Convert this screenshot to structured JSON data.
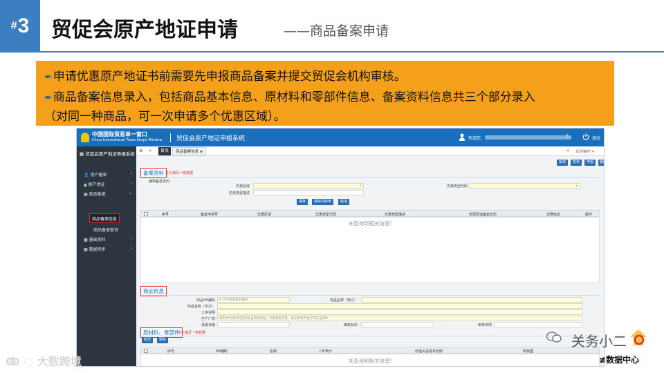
{
  "slide": {
    "hash": "#",
    "number": "3",
    "title": "贸促会原产地证申请",
    "subtitle": "——商品备案申请"
  },
  "callout": {
    "line1": "申请优惠原产地证书前需要先申报商品备案并提交贸促会机构审核。",
    "line2": "商品备案信息录入，包括商品基本信息、原材料和零部件信息、备案资料信息共三个部分录入",
    "line3": "（对同一种商品，可一次申请多个优惠区域）。"
  },
  "app": {
    "logo_cn": "中国国际贸易单一窗口",
    "logo_en": "China International Trade Single Window",
    "system_title": "贸促会原产地证申报系统",
    "welcome": "欢迎您,",
    "welcome_suffix": "5",
    "logout": "退出"
  },
  "sidebar": {
    "header": "贸促会原产地证申报系统",
    "items": [
      {
        "label": "用户备案"
      },
      {
        "label": "原产地证"
      },
      {
        "label": "商品备案"
      }
    ],
    "active_sub": "商品备案信息",
    "sub2": "商品备案查询",
    "items2": [
      {
        "label": "基础资料"
      },
      {
        "label": "数据同步"
      }
    ]
  },
  "tabs": {
    "home": "首页",
    "current": "商品备案信息 ⊗",
    "right": "关闭操作 ▾"
  },
  "toolbar": {
    "b1": "新增",
    "b2": "暂存",
    "b3": "申报",
    "b4": "删除"
  },
  "section1": {
    "label": "备案资料",
    "note": "至少填写一条数据",
    "sub": "编辑备案资料",
    "f1_label": "优惠区域",
    "f2_label": "优惠类型代码",
    "f3_label": "优惠类型描述"
  },
  "actions": {
    "save": "保存",
    "save_new": "保存并新增",
    "cancel": "取消"
  },
  "table1": {
    "headers": [
      "序号",
      "备案申请号",
      "优惠区域",
      "优惠类型代码",
      "优惠类型描述",
      "优惠区域备案状态",
      "详细信息",
      "操作"
    ],
    "empty": "未查询到相关信息!"
  },
  "section2": {
    "label": "商品信息",
    "hs_label": "商品HS编码",
    "hs_placeholder": "6  10位海关商品编码",
    "name_en_label": "商品名称（英文）",
    "name_cn_label": "商品名称（中文）",
    "process_label": "工序说明",
    "maker_label": "生产厂商",
    "maker_placeholder": "请用中文填写制造商的名称和地址，只能填报实际，此信息将不会打印在证书中",
    "date_label": "录报日期",
    "audit_status_label": "审核状态",
    "audit_detail_label": "审核详情"
  },
  "section3": {
    "label": "原材料、零部件",
    "note": "至少填写一条数据",
    "b1": "新增",
    "b2": "删除"
  },
  "table2": {
    "headers": [
      "序号",
      "HS编码",
      "名称",
      "CIF单价",
      "价值占总成本比例",
      "所属国"
    ],
    "empty": "未查询到相关信息!"
  },
  "brand": {
    "line1": "关务小二",
    "line2": "数据中心",
    "watermark": "大数跨境"
  }
}
